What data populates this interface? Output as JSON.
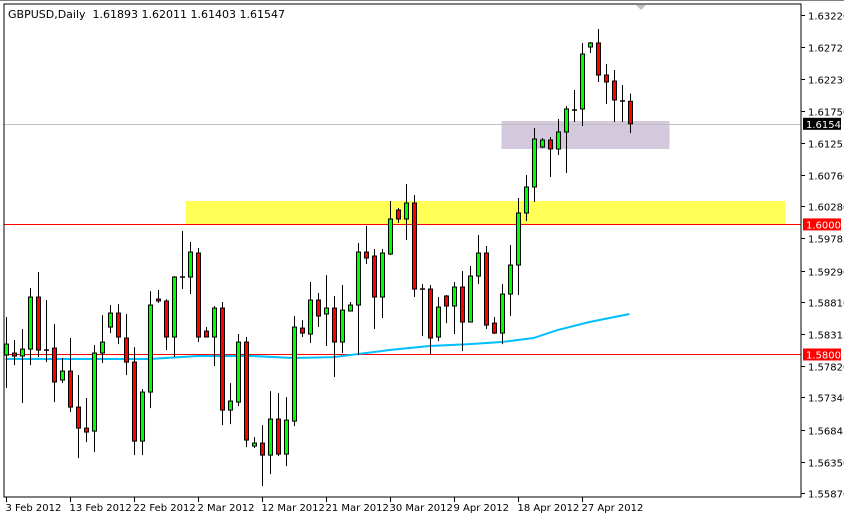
{
  "chart_data": {
    "type": "candlestick",
    "title": "GBPUSD,Daily",
    "symbol": "GBPUSD",
    "timeframe": "Daily",
    "last_bar": {
      "open": "1.61893",
      "high": "1.62011",
      "low": "1.61403",
      "close": "1.61547"
    },
    "ylim": [
      1.5587,
      1.6322
    ],
    "y_ticks": [
      "1.63220",
      "1.62725",
      "1.62230",
      "1.61750",
      "1.61255",
      "1.60760",
      "1.60280",
      "1.59785",
      "1.59290",
      "1.58810",
      "1.58315",
      "1.57820",
      "1.57340",
      "1.56845",
      "1.56350",
      "1.55870"
    ],
    "x_ticks": [
      {
        "index": 0,
        "label": "3 Feb 2012"
      },
      {
        "index": 8,
        "label": "13 Feb 2012"
      },
      {
        "index": 16,
        "label": "22 Feb 2012"
      },
      {
        "index": 24,
        "label": "2 Mar 2012"
      },
      {
        "index": 32,
        "label": "12 Mar 2012"
      },
      {
        "index": 40,
        "label": "21 Mar 2012"
      },
      {
        "index": 48,
        "label": "30 Mar 2012"
      },
      {
        "index": 56,
        "label": "9 Apr 2012"
      },
      {
        "index": 64,
        "label": "18 Apr 2012"
      },
      {
        "index": 72,
        "label": "27 Apr 2012"
      }
    ],
    "ohlc": [
      [
        1.57991,
        1.58576,
        1.57484,
        1.5816
      ],
      [
        1.58022,
        1.58222,
        1.57837,
        1.57976
      ],
      [
        1.57976,
        1.58391,
        1.57253,
        1.58083
      ],
      [
        1.58083,
        1.59022,
        1.57837,
        1.58883
      ],
      [
        1.58883,
        1.59268,
        1.5796,
        1.58068
      ],
      [
        1.58068,
        1.58837,
        1.57883,
        1.58068
      ],
      [
        1.58099,
        1.58468,
        1.57268,
        1.57576
      ],
      [
        1.57607,
        1.57945,
        1.5756,
        1.57745
      ],
      [
        1.57745,
        1.58253,
        1.57114,
        1.57191
      ],
      [
        1.57191,
        1.57683,
        1.56407,
        1.56868
      ],
      [
        1.56868,
        1.5733,
        1.56653,
        1.56807
      ],
      [
        1.56822,
        1.58145,
        1.56499,
        1.58022
      ],
      [
        1.58022,
        1.58606,
        1.57868,
        1.58191
      ],
      [
        1.58422,
        1.5876,
        1.58329,
        1.58637
      ],
      [
        1.58637,
        1.58775,
        1.5816,
        1.58268
      ],
      [
        1.58253,
        1.58622,
        1.57683,
        1.57883
      ],
      [
        1.57883,
        1.58114,
        1.56453,
        1.56668
      ],
      [
        1.56668,
        1.57468,
        1.56453,
        1.57422
      ],
      [
        1.57422,
        1.58975,
        1.57176,
        1.5876
      ],
      [
        1.58852,
        1.58991,
        1.58791,
        1.58822
      ],
      [
        1.58822,
        1.58852,
        1.58068,
        1.58268
      ],
      [
        1.58268,
        1.59206,
        1.5796,
        1.59191
      ],
      [
        1.59191,
        1.59898,
        1.59006,
        1.59191
      ],
      [
        1.59191,
        1.59729,
        1.58929,
        1.59575
      ],
      [
        1.5956,
        1.59637,
        1.58191,
        1.58268
      ],
      [
        1.5836,
        1.58422,
        1.58268,
        1.58268
      ],
      [
        1.58268,
        1.58745,
        1.57822,
        1.58714
      ],
      [
        1.58714,
        1.58806,
        1.56914,
        1.57145
      ],
      [
        1.57145,
        1.5756,
        1.5693,
        1.57284
      ],
      [
        1.57268,
        1.58314,
        1.57207,
        1.58191
      ],
      [
        1.58191,
        1.58268,
        1.56576,
        1.56684
      ],
      [
        1.56592,
        1.5673,
        1.56561,
        1.56638
      ],
      [
        1.56638,
        1.56914,
        1.55976,
        1.56453
      ],
      [
        1.56453,
        1.57437,
        1.56161,
        1.57007
      ],
      [
        1.57007,
        1.57407,
        1.56438,
        1.56468
      ],
      [
        1.56468,
        1.57345,
        1.56284,
        1.56991
      ],
      [
        1.56976,
        1.58591,
        1.56899,
        1.58422
      ],
      [
        1.58406,
        1.58529,
        1.58268,
        1.58329
      ],
      [
        1.58314,
        1.59114,
        1.58176,
        1.58837
      ],
      [
        1.58837,
        1.58945,
        1.58422,
        1.58591
      ],
      [
        1.58622,
        1.59221,
        1.5813,
        1.58714
      ],
      [
        1.58714,
        1.58899,
        1.57653,
        1.58191
      ],
      [
        1.58191,
        1.59068,
        1.58022,
        1.58683
      ],
      [
        1.58668,
        1.58806,
        1.58668,
        1.5876
      ],
      [
        1.5876,
        1.59714,
        1.57991,
        1.59575
      ],
      [
        1.59575,
        1.59975,
        1.59391,
        1.59483
      ],
      [
        1.59514,
        1.59621,
        1.58391,
        1.58883
      ],
      [
        1.58883,
        1.59621,
        1.5856,
        1.5956
      ],
      [
        1.59545,
        1.6036,
        1.59529,
        1.60083
      ],
      [
        1.60221,
        1.60252,
        1.60021,
        1.60083
      ],
      [
        1.60083,
        1.60621,
        1.5976,
        1.60329
      ],
      [
        1.60329,
        1.60452,
        1.58883,
        1.59006
      ],
      [
        1.59006,
        1.59083,
        1.58283,
        1.59006
      ],
      [
        1.59006,
        1.59068,
        1.58006,
        1.58253
      ],
      [
        1.58268,
        1.58883,
        1.58206,
        1.58729
      ],
      [
        1.58899,
        1.58914,
        1.58483,
        1.58745
      ],
      [
        1.58745,
        1.59114,
        1.58314,
        1.59037
      ],
      [
        1.59037,
        1.59283,
        1.58053,
        1.58499
      ],
      [
        1.58499,
        1.5936,
        1.58499,
        1.59206
      ],
      [
        1.59206,
        1.59837,
        1.59083,
        1.5956
      ],
      [
        1.5956,
        1.59668,
        1.58391,
        1.58452
      ],
      [
        1.58483,
        1.58576,
        1.58314,
        1.58329
      ],
      [
        1.58329,
        1.59083,
        1.5816,
        1.58929
      ],
      [
        1.58929,
        1.59683,
        1.58591,
        1.59375
      ],
      [
        1.59375,
        1.60406,
        1.58914,
        1.60175
      ],
      [
        1.60175,
        1.60759,
        1.60052,
        1.60575
      ],
      [
        1.60575,
        1.61482,
        1.60344,
        1.61313
      ],
      [
        1.6119,
        1.61329,
        1.61175,
        1.61298
      ],
      [
        1.61298,
        1.61344,
        1.60729,
        1.61159
      ],
      [
        1.61159,
        1.61621,
        1.61067,
        1.61421
      ],
      [
        1.61421,
        1.61821,
        1.6079,
        1.61775
      ],
      [
        1.61759,
        1.62067,
        1.61575,
        1.61759
      ],
      [
        1.61775,
        1.6279,
        1.61513,
        1.6262
      ],
      [
        1.62728,
        1.62805,
        1.62636,
        1.6279
      ],
      [
        1.6279,
        1.63005,
        1.6219,
        1.62297
      ],
      [
        1.62297,
        1.62467,
        1.61851,
        1.6219
      ],
      [
        1.62205,
        1.62374,
        1.61575,
        1.61913
      ],
      [
        1.61898,
        1.62144,
        1.61575,
        1.61898
      ],
      [
        1.61893,
        1.62011,
        1.61403,
        1.61547
      ]
    ],
    "moving_average": [
      [
        0,
        1.5793
      ],
      [
        18,
        1.5793
      ],
      [
        24,
        1.57976
      ],
      [
        31,
        1.57976
      ],
      [
        36,
        1.57945
      ],
      [
        41,
        1.5796
      ],
      [
        48,
        1.58068
      ],
      [
        53,
        1.5813
      ],
      [
        58,
        1.5816
      ],
      [
        62,
        1.58191
      ],
      [
        66,
        1.58253
      ],
      [
        69,
        1.58376
      ],
      [
        73,
        1.58499
      ],
      [
        78,
        1.58622
      ]
    ],
    "horizontal_levels": [
      {
        "price": 1.6,
        "label": "1.60000",
        "color": "#ff0000"
      },
      {
        "price": 1.58,
        "label": "1.58000",
        "color": "#ff0000"
      }
    ],
    "bid_line": {
      "price": 1.61547,
      "label": "1.61547",
      "color": "#c0c0c0"
    },
    "zones": [
      {
        "name": "resistance-zone",
        "from_index": 22.5,
        "to_index": 97.5,
        "price_low": 1.6,
        "price_high": 1.6036,
        "color": "#ffff55"
      },
      {
        "name": "support-zone",
        "from_index": 62,
        "to_index": 83,
        "price_low": 1.61159,
        "price_high": 1.6159,
        "color": "#d4c8dc"
      }
    ],
    "colors": {
      "bull": "#00ff00",
      "bear": "#ff0000",
      "ma": "#00bfff"
    }
  }
}
